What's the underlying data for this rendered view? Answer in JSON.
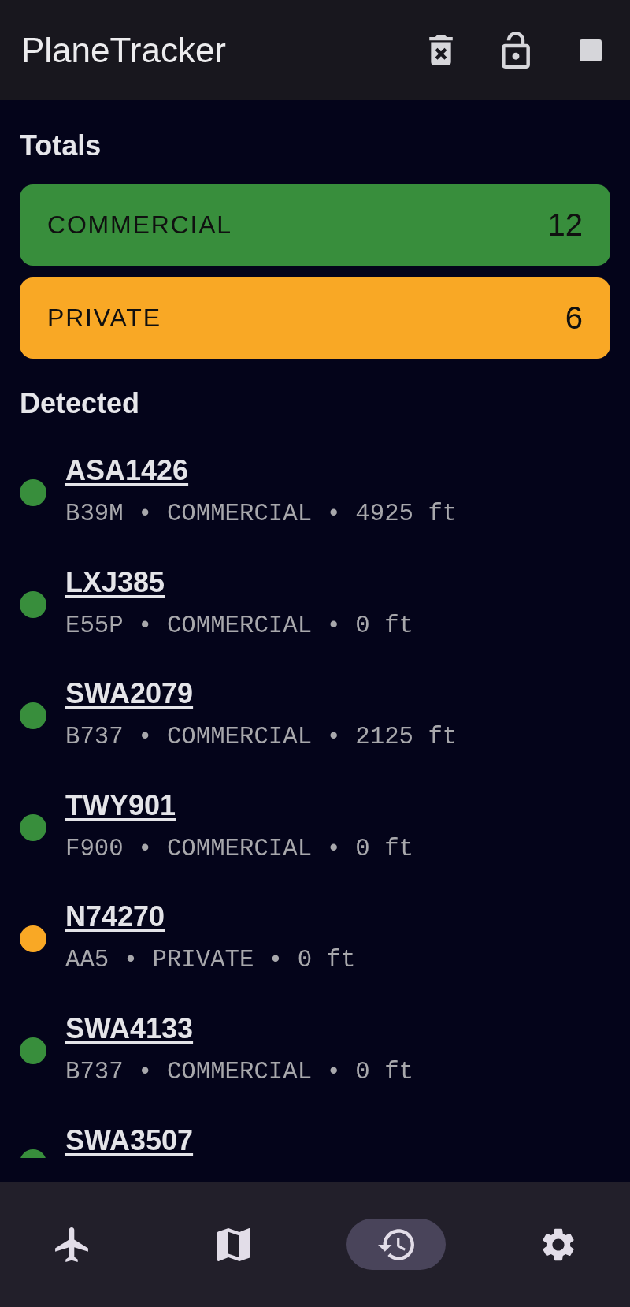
{
  "header": {
    "title": "PlaneTracker"
  },
  "totals": {
    "title": "Totals",
    "items": [
      {
        "label": "COMMERCIAL",
        "count": "12",
        "color": "#388e3c"
      },
      {
        "label": "PRIVATE",
        "count": "6",
        "color": "#f9a825"
      }
    ]
  },
  "detected": {
    "title": "Detected",
    "items": [
      {
        "callsign": "ASA1426",
        "details": "B39M • COMMERCIAL • 4925 ft",
        "color": "#388e3c"
      },
      {
        "callsign": "LXJ385",
        "details": "E55P • COMMERCIAL • 0 ft",
        "color": "#388e3c"
      },
      {
        "callsign": "SWA2079",
        "details": "B737 • COMMERCIAL • 2125 ft",
        "color": "#388e3c"
      },
      {
        "callsign": "TWY901",
        "details": "F900 • COMMERCIAL • 0 ft",
        "color": "#388e3c"
      },
      {
        "callsign": "N74270",
        "details": "AA5 • PRIVATE • 0 ft",
        "color": "#f9a825"
      },
      {
        "callsign": "SWA4133",
        "details": "B737 • COMMERCIAL • 0 ft",
        "color": "#388e3c"
      },
      {
        "callsign": "SWA3507",
        "color": "#388e3c"
      }
    ]
  },
  "bottom_nav": [
    {
      "selected": false
    },
    {
      "selected": false
    },
    {
      "selected": true
    },
    {
      "selected": false
    }
  ]
}
